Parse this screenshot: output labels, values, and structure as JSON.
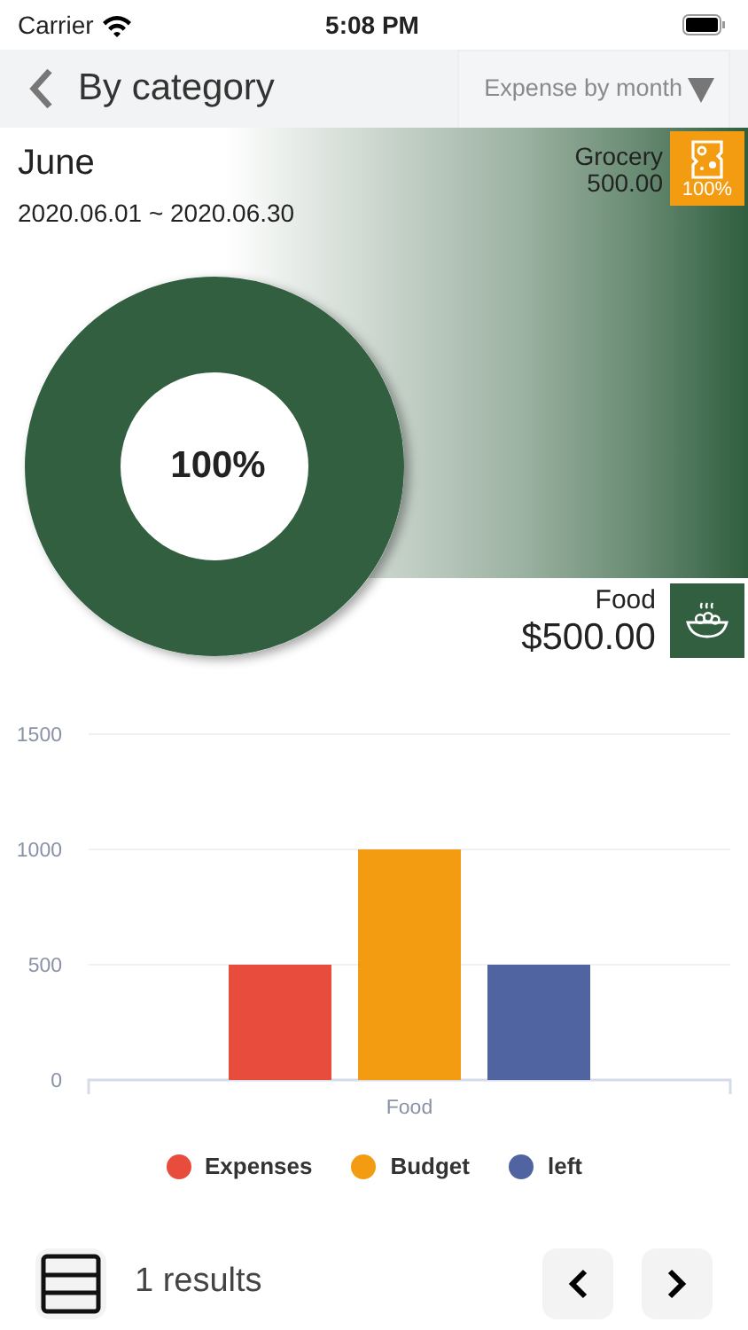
{
  "status_bar": {
    "carrier": "Carrier",
    "time": "5:08 PM"
  },
  "nav": {
    "title": "By category",
    "dropdown": "Expense by month"
  },
  "period": {
    "month": "June",
    "range": "2020.06.01 ~ 2020.06.30"
  },
  "top_category": {
    "name": "Grocery",
    "amount": "500.00",
    "percent": "100%",
    "color": "#f39c12"
  },
  "donut": {
    "center_label": "100%",
    "level": 1
  },
  "selected_category": {
    "name": "Food",
    "amount": "$500.00",
    "color": "#325f40"
  },
  "bar_chart": {
    "chart_data": {
      "type": "bar",
      "categories": [
        "Food"
      ],
      "series": [
        {
          "name": "Expenses",
          "color": "#e74c3c",
          "values": [
            500
          ]
        },
        {
          "name": "Budget",
          "color": "#f39c12",
          "values": [
            1000
          ]
        },
        {
          "name": "left",
          "color": "#4f64a0",
          "values": [
            500
          ]
        }
      ],
      "ylim": [
        0,
        1500
      ],
      "yticks": [
        0,
        500,
        1000,
        1500
      ],
      "legend": "bottom"
    }
  },
  "footer": {
    "results": "1 results"
  }
}
